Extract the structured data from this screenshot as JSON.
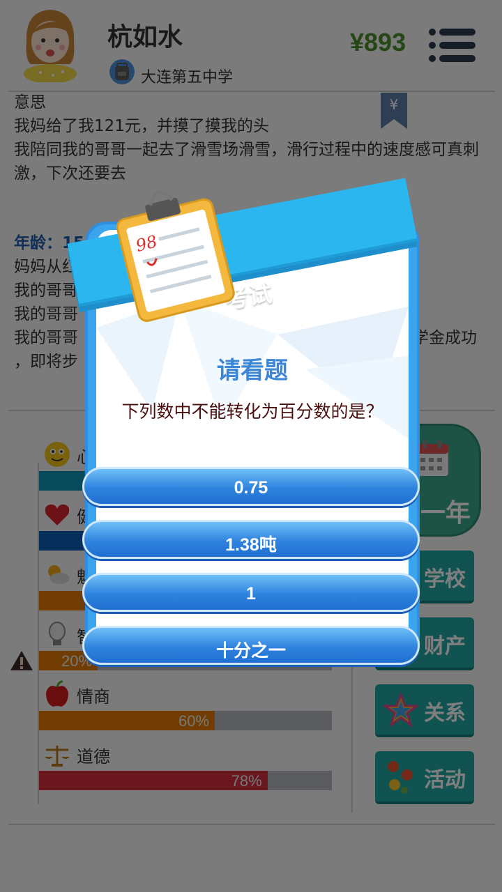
{
  "header": {
    "player_name": "杭如水",
    "school_name": "大连第五中学",
    "money": "¥893"
  },
  "log": {
    "lines_top": [
      "意思",
      "我妈给了我121元，并摸了摸我的头",
      "我陪同我的哥哥一起去了滑雪场滑雪，滑行过程中的速度感可真刺激，下次还要去"
    ],
    "age_label": "年龄：15",
    "lines_bottom": [
      "妈妈从红",
      "我的哥哥",
      "我的哥哥",
      "我的哥哥",
      "学金成功",
      "，即将步"
    ],
    "bookmark_symbol": "¥"
  },
  "stats": [
    {
      "label": "心",
      "percent": 0.33,
      "pct_text": "",
      "color": "#0f95b8",
      "icon": "smiley-icon"
    },
    {
      "label": "健",
      "percent": 0.33,
      "pct_text": "",
      "color": "#0a5db5",
      "icon": "heart-icon"
    },
    {
      "label": "魅",
      "percent": 0.33,
      "pct_text": "",
      "color": "#e27b07",
      "icon": "weather-icon"
    },
    {
      "label": "智",
      "percent": 0.2,
      "pct_text": "20%",
      "color": "#e27b07",
      "icon": "lightbulb-icon"
    },
    {
      "label": "情商",
      "percent": 0.6,
      "pct_text": "60%",
      "color": "#e27b07",
      "icon": "apple-icon"
    },
    {
      "label": "道德",
      "percent": 0.78,
      "pct_text": "78%",
      "color": "#d42f3f",
      "icon": "scales-icon"
    }
  ],
  "right_buttons": {
    "year": "一年",
    "school": "学校",
    "assets": "财产",
    "relations": "关系",
    "activities": "活动"
  },
  "modal": {
    "ribbon_title": "考试",
    "question_title": "请看题",
    "question_text": "下列数中不能转化为百分数的是？",
    "options": [
      "0.75",
      "1.38吨",
      "1",
      "十分之一"
    ],
    "clipboard_score": "98"
  }
}
